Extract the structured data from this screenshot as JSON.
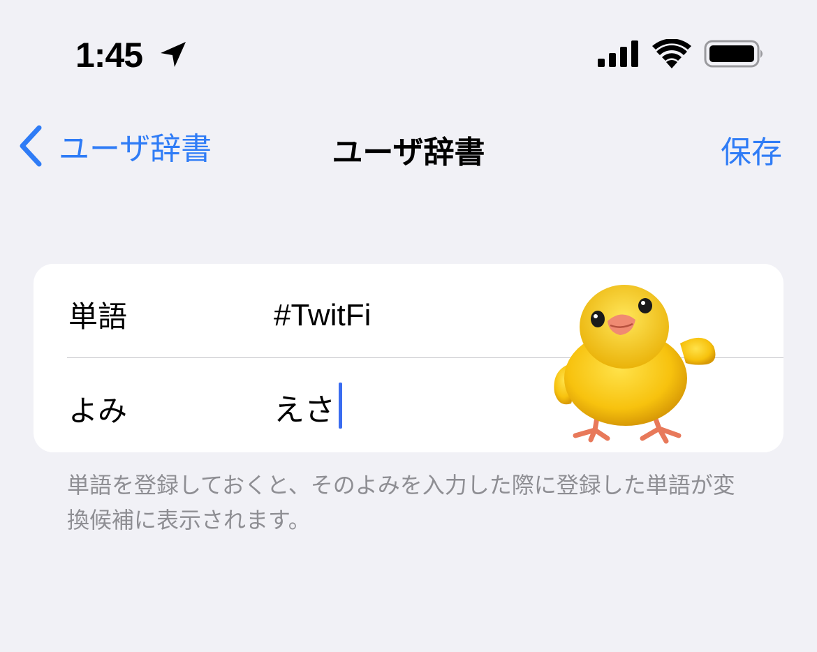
{
  "status_bar": {
    "time": "1:45",
    "location_icon": "location-arrow-icon",
    "signal_icon": "cellular-signal-icon",
    "wifi_icon": "wifi-icon",
    "battery_icon": "battery-icon"
  },
  "nav": {
    "back_label": "ユーザ辞書",
    "title": "ユーザ辞書",
    "save_label": "保存"
  },
  "form": {
    "word_label": "単語",
    "word_value": "#TwitFi",
    "reading_label": "よみ",
    "reading_value": "えさ"
  },
  "footer_note": "単語を登録しておくと、そのよみを入力した際に登録した単語が変換候補に表示されます。",
  "colors": {
    "accent": "#2f7cf6",
    "background": "#f1f1f6",
    "cursor": "#3a6cf0"
  },
  "sticker": "yellow-chick-illustration"
}
